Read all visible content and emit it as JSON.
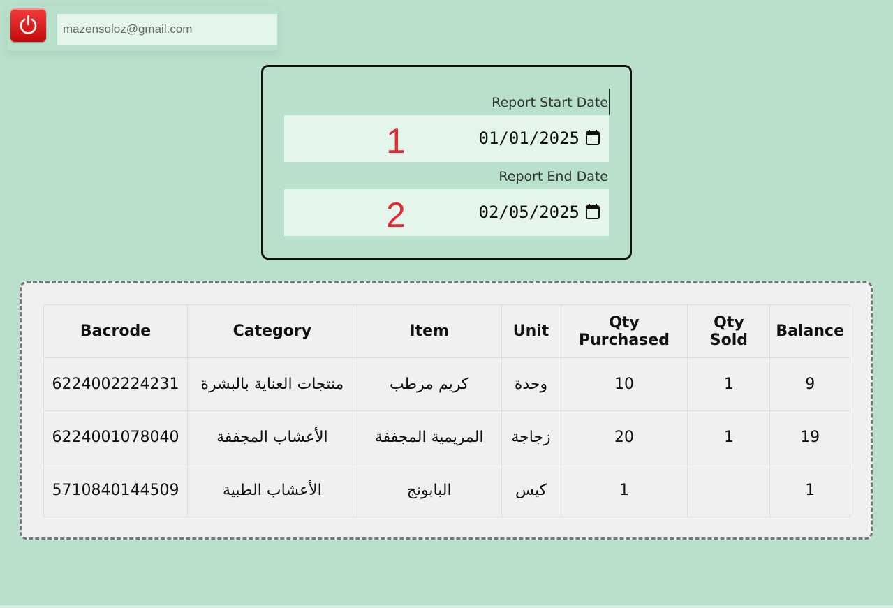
{
  "user": {
    "email": "mazensoloz@gmail.com"
  },
  "report": {
    "start_label": "Report Start Date",
    "start_value": "01/01/2025",
    "start_marker": "1",
    "end_label": "Report End Date",
    "end_value": "02/05/2025",
    "end_marker": "2"
  },
  "table": {
    "headers": [
      "Bacrode",
      "Category",
      "Item",
      "Unit",
      "Qty Purchased",
      "Qty Sold",
      "Balance"
    ],
    "rows": [
      [
        "6224002224231",
        "منتجات العناية بالبشرة",
        "كريم مرطب",
        "وحدة",
        "10",
        "1",
        "9"
      ],
      [
        "6224001078040",
        "الأعشاب المجففة",
        "المريمية المجففة",
        "زجاجة",
        "20",
        "1",
        "19"
      ],
      [
        "5710840144509",
        "الأعشاب الطبية",
        "البابونج",
        "كيس",
        "1",
        "",
        "1"
      ]
    ]
  },
  "icons": {
    "power": "power-icon",
    "calendar": "calendar-icon"
  },
  "colors": {
    "background": "#b8e0cb",
    "power_button": "#d81515",
    "marker": "#e22b36"
  }
}
